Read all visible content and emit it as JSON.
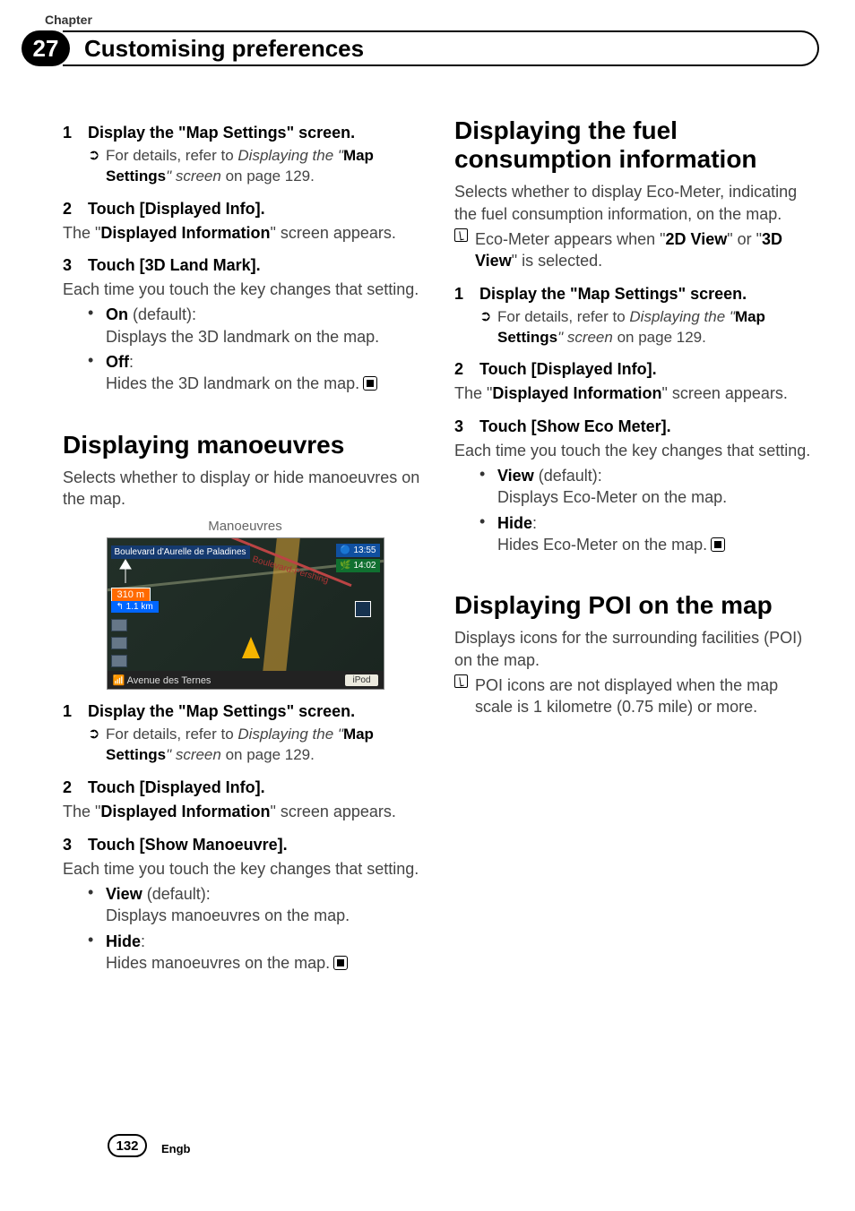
{
  "header": {
    "chapter_label": "Chapter",
    "chapter_number": "27",
    "chapter_title": "Customising preferences"
  },
  "left": {
    "sec1": {
      "s1_num": "1",
      "s1_txt": "Display the \"Map Settings\" screen.",
      "s1_ref_pre": "For details, refer to ",
      "s1_ref_ital": "Displaying the \"",
      "s1_ref_bold": "Map Settings",
      "s1_ref_ital2": "\" screen",
      "s1_ref_post": " on page 129.",
      "s2_num": "2",
      "s2_txt": "Touch [Displayed Info].",
      "s2_body_pre": "The \"",
      "s2_body_bold": "Displayed Information",
      "s2_body_post": "\" screen appears.",
      "s3_num": "3",
      "s3_txt": "Touch [3D Land Mark].",
      "s3_body": "Each time you touch the key changes that setting.",
      "b1_label": "On",
      "b1_suffix": " (default):",
      "b1_desc": "Displays the 3D landmark on the map.",
      "b2_label": "Off",
      "b2_suffix": ":",
      "b2_desc": "Hides the 3D landmark on the map."
    },
    "sec2": {
      "title": "Displaying manoeuvres",
      "intro": "Selects whether to display or hide manoeuvres on the map.",
      "fig_label": "Manoeuvres",
      "map": {
        "top_label": "Boulevard d'Aurelle de Paladines",
        "diag_label": "Boulevard-Pershing",
        "dist1": "310 m",
        "dist2": "1.1 km",
        "time1": "13:55",
        "time2": "14:02",
        "bottom_label": "Avenue des Ternes",
        "ipod": "iPod"
      },
      "s1_num": "1",
      "s1_txt": "Display the \"Map Settings\" screen.",
      "s1_ref_pre": "For details, refer to ",
      "s1_ref_ital": "Displaying the \"",
      "s1_ref_bold": "Map Settings",
      "s1_ref_ital2": "\" screen",
      "s1_ref_post": " on page 129.",
      "s2_num": "2",
      "s2_txt": "Touch [Displayed Info].",
      "s2_body_pre": "The \"",
      "s2_body_bold": "Displayed Information",
      "s2_body_post": "\" screen appears.",
      "s3_num": "3",
      "s3_txt": "Touch [Show Manoeuvre].",
      "s3_body": "Each time you touch the key changes that setting.",
      "b1_label": "View",
      "b1_suffix": " (default):",
      "b1_desc": "Displays manoeuvres on the map.",
      "b2_label": "Hide",
      "b2_suffix": ":",
      "b2_desc": "Hides manoeuvres on the map."
    }
  },
  "right": {
    "sec1": {
      "title": "Displaying the fuel consumption information",
      "intro": "Selects whether to display Eco-Meter, indicating the fuel consumption information, on the map.",
      "note_pre": "Eco-Meter appears when \"",
      "note_b1": "2D View",
      "note_mid": "\" or \"",
      "note_b2": "3D View",
      "note_post": "\" is selected.",
      "s1_num": "1",
      "s1_txt": "Display the \"Map Settings\" screen.",
      "s1_ref_pre": "For details, refer to ",
      "s1_ref_ital": "Displaying the \"",
      "s1_ref_bold": "Map Settings",
      "s1_ref_ital2": "\" screen",
      "s1_ref_post": " on page 129.",
      "s2_num": "2",
      "s2_txt": "Touch [Displayed Info].",
      "s2_body_pre": "The \"",
      "s2_body_bold": "Displayed Information",
      "s2_body_post": "\" screen appears.",
      "s3_num": "3",
      "s3_txt": "Touch [Show Eco Meter].",
      "s3_body": "Each time you touch the key changes that setting.",
      "b1_label": "View",
      "b1_suffix": " (default):",
      "b1_desc": "Displays Eco-Meter on the map.",
      "b2_label": "Hide",
      "b2_suffix": ":",
      "b2_desc": "Hides Eco-Meter on the map."
    },
    "sec2": {
      "title": "Displaying POI on the map",
      "intro": "Displays icons for the surrounding facilities (POI) on the map.",
      "note": "POI icons are not displayed when the map scale is 1 kilometre (0.75 mile) or more."
    }
  },
  "footer": {
    "page_num": "132",
    "lang": "Engb"
  }
}
